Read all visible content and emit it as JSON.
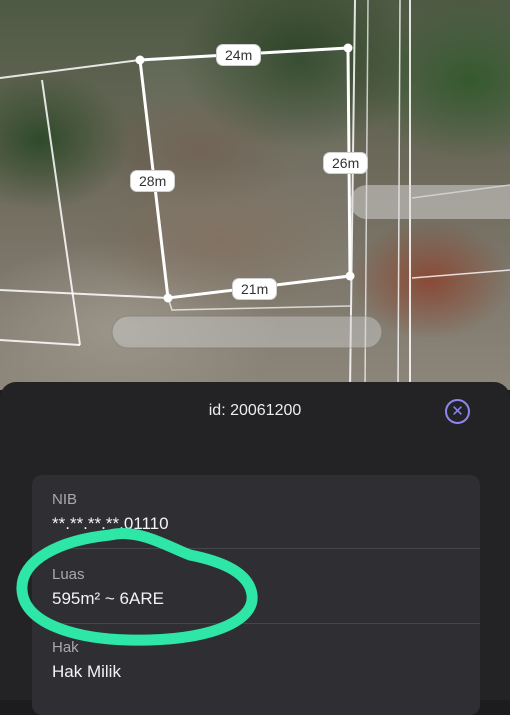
{
  "map": {
    "dimensions": [
      "24m",
      "28m",
      "26m",
      "21m"
    ]
  },
  "detail_sheet": {
    "title": "id: 20061200",
    "close_icon": "close-circle-icon",
    "accent_color": "#8e86f0",
    "fields": [
      {
        "label": "NIB",
        "value": "**.**.**.**.01110"
      },
      {
        "label": "Luas",
        "value": "595m² ~ 6ARE"
      },
      {
        "label": "Hak",
        "value": "Hak Milik"
      }
    ]
  },
  "annotation": {
    "color": "#2ee6a6"
  }
}
